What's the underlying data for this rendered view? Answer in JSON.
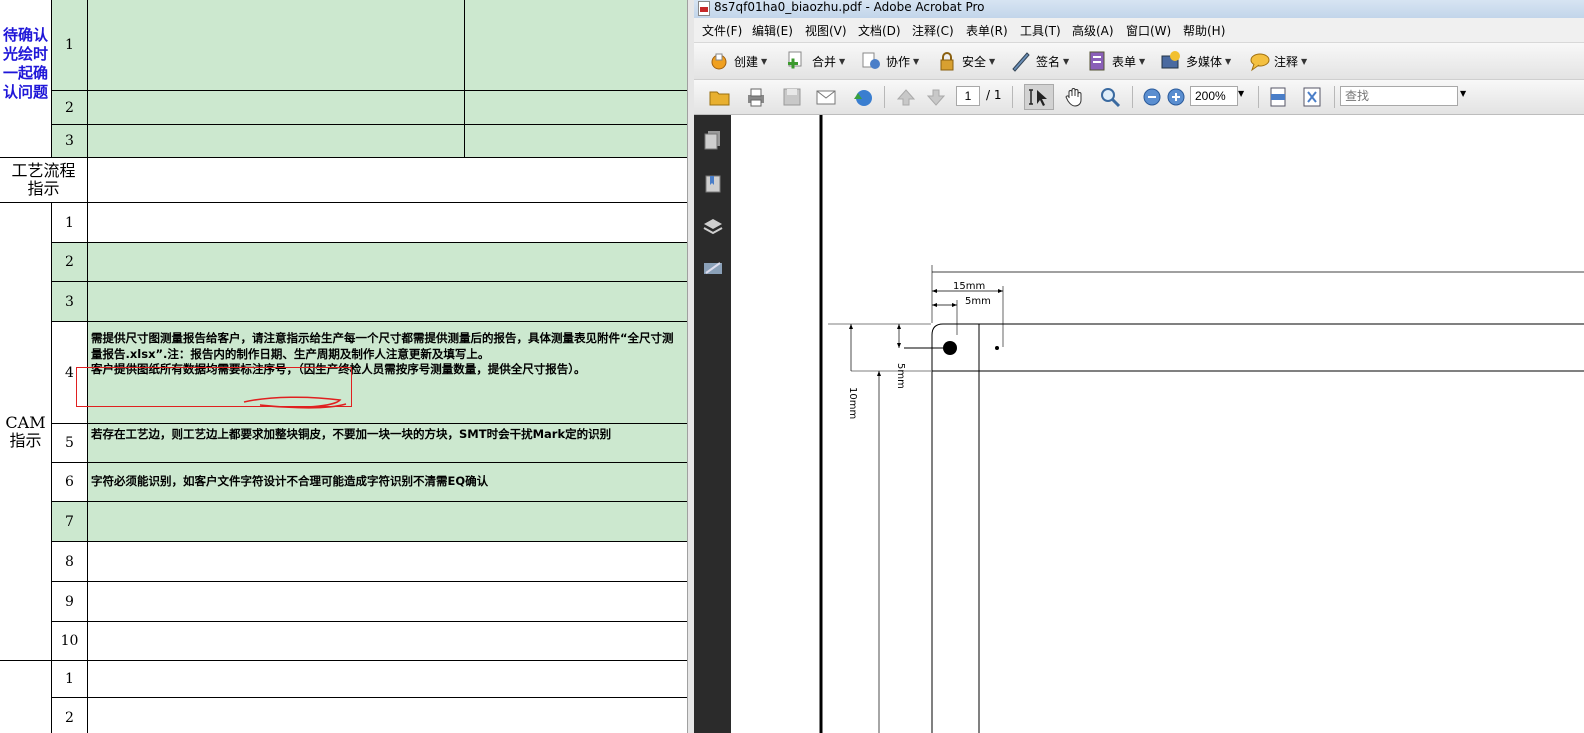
{
  "sheet": {
    "left_labels": {
      "pending": "待确认\n光绘时\n一起确\n认问题",
      "process": "工艺流程\n指示",
      "cam": "CAM\n指示"
    },
    "row_numbers": [
      "1",
      "2",
      "3",
      "1",
      "2",
      "3",
      "4",
      "5",
      "6",
      "7",
      "8",
      "9",
      "10",
      "1",
      "2"
    ],
    "cam_texts": {
      "r4_line1": "需提供尺寸图测量报告给客户，请注意指示给生产每一个尺寸都需提供测量后的报告，具体测量表见附件“全尺寸测量报告.xlsx”.注：报告内的制作日期、生产周期及制作人注意更新及填写上。",
      "r4_line2": "客户提供图纸所有数据均需要标注序号，（因生产终检人员需按序号测量数量，提供全尺寸报告）。",
      "r5": "若存在工艺边，则工艺边上都要求加整块铜皮，不要加一块一块的方块，SMT时会干扰Mark定的识别",
      "r6": "字符必须能识别，如客户文件字符设计不合理可能造成字符识别不清需EQ确认"
    }
  },
  "acrobat": {
    "window_title": "8s7qf01ha0_biaozhu.pdf - Adobe Acrobat Pro",
    "menus": [
      "文件(F)",
      "编辑(E)",
      "视图(V)",
      "文档(D)",
      "注释(C)",
      "表单(R)",
      "工具(T)",
      "高级(A)",
      "窗口(W)",
      "帮助(H)"
    ],
    "toolbar1": {
      "create": "创建",
      "combine": "合并",
      "collaborate": "协作",
      "secure": "安全",
      "sign": "签名",
      "forms": "表单",
      "multimedia": "多媒体",
      "comment": "注释"
    },
    "toolbar2": {
      "page_current": "1",
      "page_total": "/ 1",
      "zoom": "200%",
      "search_placeholder": "查找"
    },
    "drawing": {
      "dim_15": "15mm",
      "dim_5_h": "5mm",
      "dim_5_v": "5mm",
      "dim_10": "10mm"
    }
  }
}
